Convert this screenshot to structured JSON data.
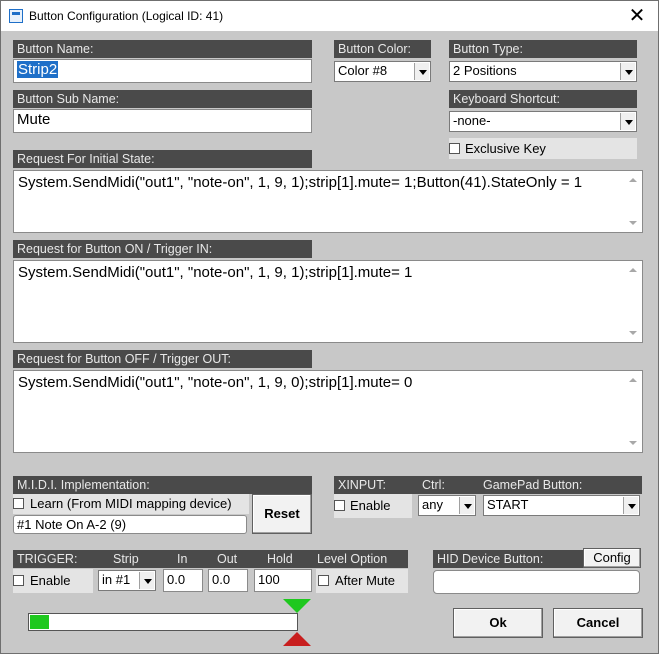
{
  "window": {
    "title": "Button Configuration (Logical ID: 41)",
    "close_glyph": "✕"
  },
  "button_name": {
    "label": "Button Name:",
    "value": "Strip2"
  },
  "button_sub_name": {
    "label": "Button Sub Name:",
    "value": "Mute"
  },
  "button_color": {
    "label": "Button Color:",
    "value": "Color #8"
  },
  "button_type": {
    "label": "Button Type:",
    "value": "2 Positions"
  },
  "keyboard_shortcut": {
    "label": "Keyboard Shortcut:",
    "value": "-none-"
  },
  "exclusive_key": {
    "label": "Exclusive Key",
    "checked": false
  },
  "initial_state": {
    "label": "Request For Initial State:",
    "value": "System.SendMidi(\"out1\", \"note-on\", 1, 9, 1);strip[1].mute= 1;Button(41).StateOnly = 1"
  },
  "button_on": {
    "label": "Request for Button ON / Trigger IN:",
    "value": "System.SendMidi(\"out1\", \"note-on\", 1, 9, 1);strip[1].mute= 1"
  },
  "button_off": {
    "label": "Request for Button OFF / Trigger OUT:",
    "value": "System.SendMidi(\"out1\", \"note-on\", 1, 9, 0);strip[1].mute= 0"
  },
  "midi": {
    "label": "M.I.D.I. Implementation:",
    "learn_label": "Learn (From MIDI mapping device)",
    "learn_checked": false,
    "mapping": "#1 Note On A-2 (9)",
    "reset_label": "Reset"
  },
  "xinput": {
    "label": "XINPUT:",
    "ctrl_label": "Ctrl:",
    "gamepad_label": "GamePad Button:",
    "enable_label": "Enable",
    "enable_checked": false,
    "ctrl_value": "any",
    "gamepad_value": "START"
  },
  "trigger": {
    "label": "TRIGGER:",
    "strip_label": "Strip",
    "in_label": "In",
    "out_label": "Out",
    "hold_label": "Hold",
    "level_option_label": "Level Option",
    "enable_label": "Enable",
    "enable_checked": false,
    "strip_value": "in #1",
    "in_value": "0.0",
    "out_value": "0.0",
    "hold_value": "100",
    "after_mute_label": "After Mute",
    "after_mute_checked": false
  },
  "hid": {
    "label": "HID Device Button:",
    "config_label": "Config",
    "value": ""
  },
  "level_meter": {
    "fill_fraction": 0.07,
    "meter_color": "#1ec81e",
    "upper_marker_color": "#1ec81e",
    "lower_marker_color": "#c81e1e"
  },
  "actions": {
    "ok_label": "Ok",
    "cancel_label": "Cancel"
  }
}
